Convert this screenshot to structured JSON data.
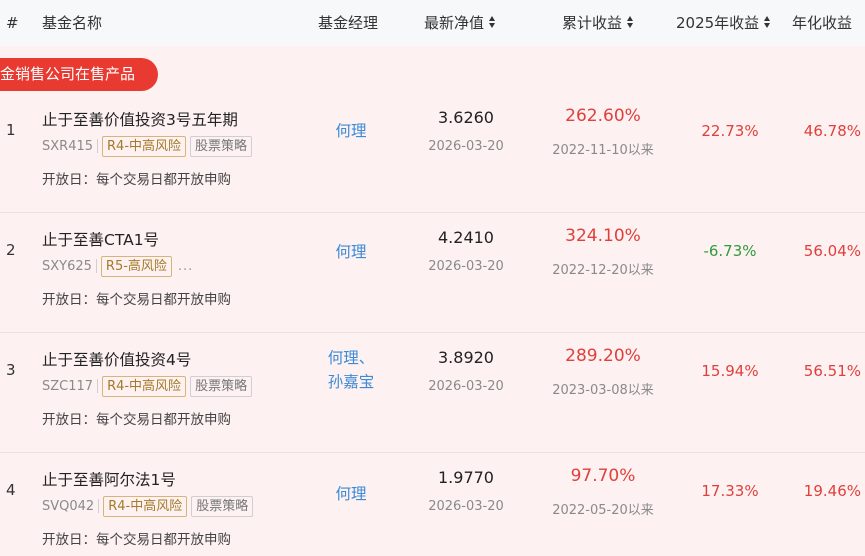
{
  "header": {
    "col_index": "#",
    "col_name": "基金名称",
    "col_manager": "基金经理",
    "col_nav": "最新净值",
    "col_cumulative": "累计收益",
    "col_2025": "2025年收益",
    "col_annualized": "年化收益"
  },
  "banner": "金销售公司在售产品",
  "funds": [
    {
      "index": "1",
      "name": "止于至善价值投资3号五年期",
      "code": "SXR415",
      "risk": "R4-中高风险",
      "strategy": "股票策略",
      "open_day": "开放日：每个交易日都开放申购",
      "manager": "何理",
      "nav": "3.6260",
      "nav_date": "2026-03-20",
      "cumulative": "262.60%",
      "since": "2022-11-10以来",
      "ret_2025": "22.73%",
      "annualized": "46.78%"
    },
    {
      "index": "2",
      "name": "止于至善CTA1号",
      "code": "SXY625",
      "risk": "R5-高风险",
      "strategy": "...",
      "open_day": "开放日：每个交易日都开放申购",
      "manager": "何理",
      "nav": "4.2410",
      "nav_date": "2026-03-20",
      "cumulative": "324.10%",
      "since": "2022-12-20以来",
      "ret_2025": "-6.73%",
      "annualized": "56.04%"
    },
    {
      "index": "3",
      "name": "止于至善价值投资4号",
      "code": "SZC117",
      "risk": "R4-中高风险",
      "strategy": "股票策略",
      "open_day": "开放日：每个交易日都开放申购",
      "manager_line1": "何理、",
      "manager_line2": "孙嘉宝",
      "nav": "3.8920",
      "nav_date": "2026-03-20",
      "cumulative": "289.20%",
      "since": "2023-03-08以来",
      "ret_2025": "15.94%",
      "annualized": "56.51%"
    },
    {
      "index": "4",
      "name": "止于至善阿尔法1号",
      "code": "SVQ042",
      "risk": "R4-中高风险",
      "strategy": "股票策略",
      "open_day": "开放日：每个交易日都开放申购",
      "manager": "何理",
      "nav": "1.9770",
      "nav_date": "2026-03-20",
      "cumulative": "97.70%",
      "since": "2022-05-20以来",
      "ret_2025": "17.33%",
      "annualized": "19.46%"
    }
  ],
  "colors": {
    "accent_red": "#e83a31",
    "positive": "#e0403b",
    "negative": "#2f9b3c",
    "link": "#3d8ad6",
    "row_bg": "#fdf1f1"
  }
}
